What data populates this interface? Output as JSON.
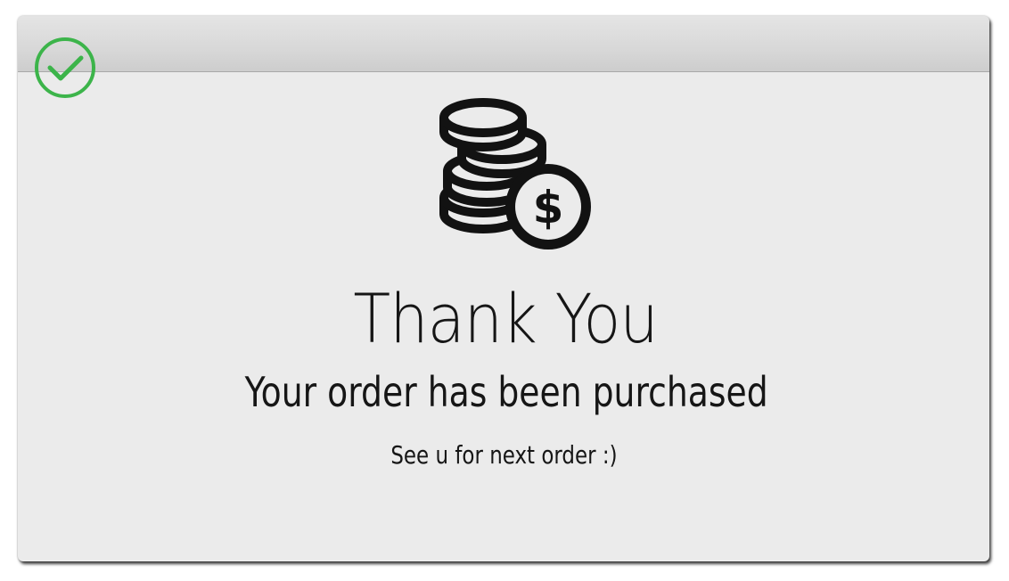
{
  "dialog": {
    "title": "Thank You",
    "subtitle": "Your order has been purchased",
    "note": "See u for next order :)"
  },
  "icons": {
    "status": "check-circle-icon",
    "main": "coins-dollar-icon"
  },
  "colors": {
    "success": "#3cb44a",
    "window_background": "#ebebeb",
    "text": "#161616"
  }
}
